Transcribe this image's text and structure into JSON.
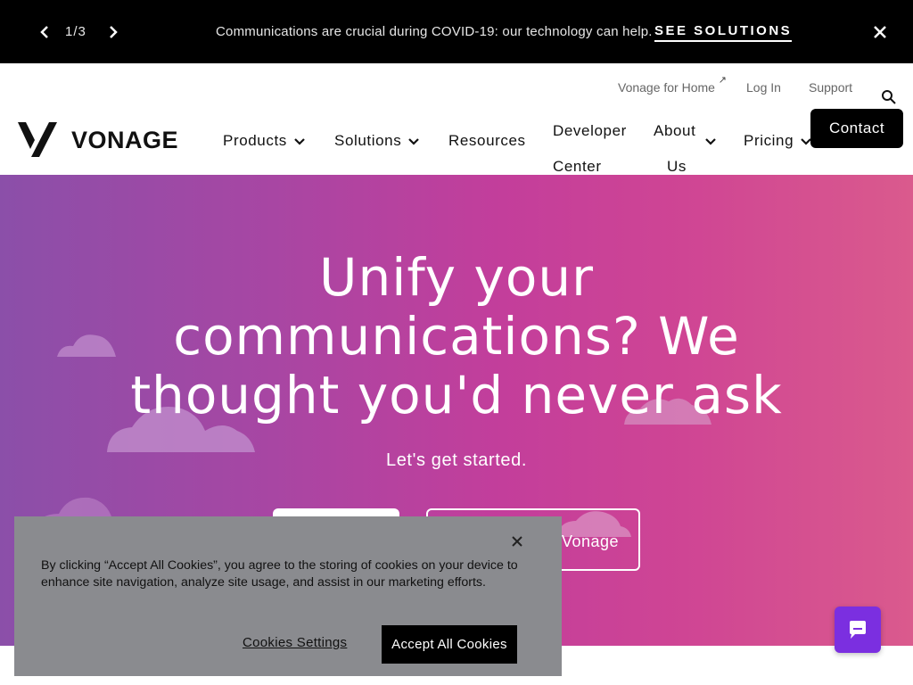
{
  "promo": {
    "counter": "1/3",
    "message": "Communications are crucial during COVID-19: our technology can help.",
    "cta": "SEE SOLUTIONS"
  },
  "header": {
    "brand": "VONAGE",
    "utility": {
      "home": "Vonage for Home",
      "login": "Log In",
      "support": "Support"
    },
    "nav": {
      "products": "Products",
      "solutions": "Solutions",
      "resources": "Resources",
      "developer_line1": "Developer",
      "developer_line2": "Center",
      "about_line1": "About",
      "about_line2": "Us",
      "pricing": "Pricing"
    },
    "contact": "Contact"
  },
  "hero": {
    "title": "Unify your communications? We thought you'd never ask",
    "subtitle": "Let's get started.",
    "secondary_button": "Vonage"
  },
  "cookie": {
    "text": "By clicking “Accept All Cookies”, you agree to the storing of cookies on your device to enhance site navigation, analyze site usage, and assist in our marketing efforts.",
    "settings": "Cookies Settings",
    "accept": "Accept All Cookies"
  },
  "colors": {
    "hero_gradient_start": "#8b4fa9",
    "hero_gradient_end": "#da5a8d",
    "chat_button": "#7b2fe0",
    "cookie_bg": "#8a8b8f"
  },
  "icons": [
    "chevron-left-icon",
    "chevron-right-icon",
    "close-icon",
    "external-link-icon",
    "search-icon",
    "chevron-down-icon",
    "chat-icon"
  ]
}
